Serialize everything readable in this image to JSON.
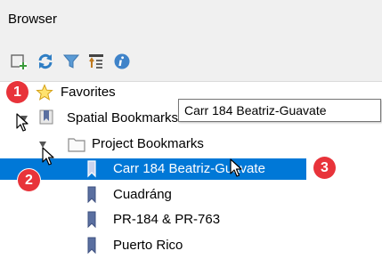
{
  "panel": {
    "title": "Browser"
  },
  "toolbar": {
    "buttons": [
      "add-layer-icon",
      "refresh-icon",
      "filter-icon",
      "collapse-all-icon",
      "info-icon"
    ]
  },
  "tree": {
    "favorites": "Favorites",
    "spatial_bookmarks": "Spatial Bookmarks",
    "project_bookmarks": "Project Bookmarks",
    "items": [
      "Carr 184 Beatriz-Guavate",
      "Cuadráng",
      "PR-184 & PR-763",
      "Puerto Rico"
    ]
  },
  "tooltip": {
    "text": "Carr 184 Beatriz-Guavate"
  },
  "badges": [
    "1",
    "2",
    "3"
  ],
  "colors": {
    "selection": "#0078d7",
    "badge": "#e8333a"
  }
}
